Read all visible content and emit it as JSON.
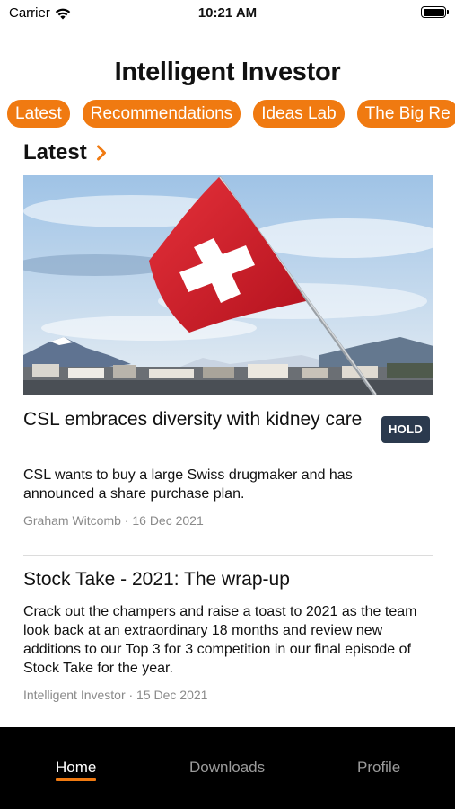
{
  "status_bar": {
    "carrier": "Carrier",
    "time": "10:21 AM"
  },
  "app": {
    "title": "Intelligent Investor"
  },
  "category_tabs": [
    {
      "label": "Latest"
    },
    {
      "label": "Recommendations"
    },
    {
      "label": "Ideas Lab"
    },
    {
      "label": "The Big Re"
    }
  ],
  "section": {
    "heading": "Latest"
  },
  "articles": [
    {
      "title": "CSL embraces diversity with kidney care",
      "badge": "HOLD",
      "summary": "CSL wants to buy a large Swiss drugmaker and has announced a share purchase plan.",
      "byline": "Graham Witcomb · 16 Dec 2021",
      "image": "swiss-flag-photo"
    },
    {
      "title": "Stock Take - 2021: The wrap-up",
      "summary": "Crack out the champers and raise a toast to 2021 as the team look back at an extraordinary 18 months and review new additions to our Top 3 for 3 competition in our final episode of Stock Take for the year.",
      "byline": "Intelligent Investor · 15 Dec 2021"
    }
  ],
  "bottom_nav": {
    "items": [
      {
        "label": "Home",
        "active": true
      },
      {
        "label": "Downloads",
        "active": false
      },
      {
        "label": "Profile",
        "active": false
      }
    ]
  },
  "colors": {
    "accent": "#f07a11",
    "badge_bg": "#2b3a4e",
    "tabbar_bg": "#000000",
    "byline": "#8a8a8a"
  },
  "icons": [
    "wifi-icon",
    "battery-icon",
    "chevron-right-icon"
  ]
}
